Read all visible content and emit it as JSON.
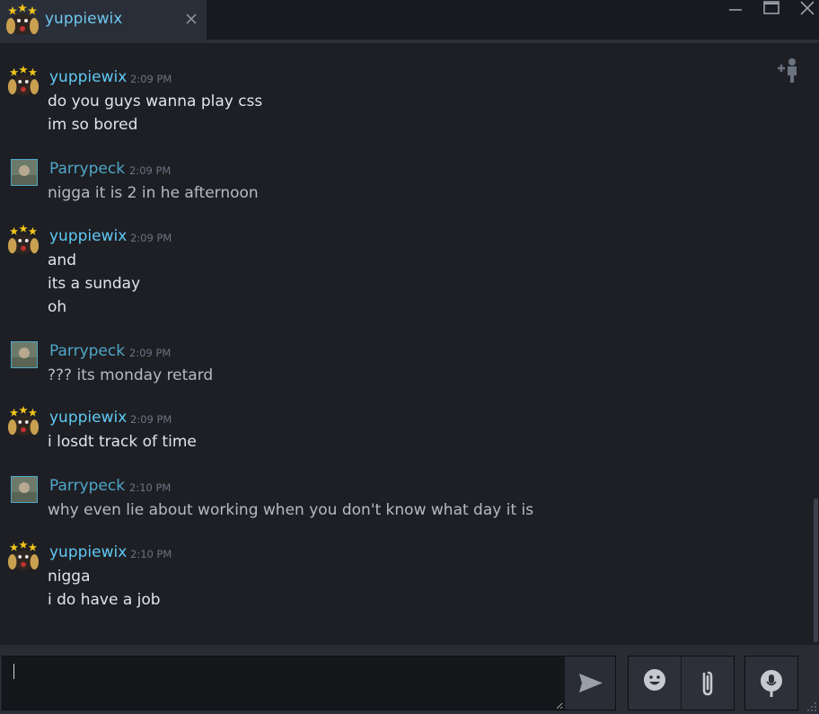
{
  "tab": {
    "name": "yuppiewix",
    "avatar_icon": "yuppiewix-avatar-icon",
    "close_icon": "close-icon"
  },
  "window_controls": {
    "minimize_icon": "minimize-icon",
    "maximize_icon": "maximize-icon",
    "close_icon": "close-icon"
  },
  "add_friend_icon": "add-friend-icon",
  "colors": {
    "self_name": "#5fcaf5",
    "other_name": "#4ea7c9",
    "background": "#1e1f24"
  },
  "messages": [
    {
      "author": "yuppiewix",
      "time": "2:09 PM",
      "avatar": "yuppiewix-avatar-icon",
      "lines": [
        "do you guys wanna play css",
        "im so bored"
      ]
    },
    {
      "author": "Parrypeck",
      "time": "2:09 PM",
      "avatar": "parrypeck-avatar-icon",
      "lines": [
        "nigga it is 2 in he afternoon"
      ]
    },
    {
      "author": "yuppiewix",
      "time": "2:09 PM",
      "avatar": "yuppiewix-avatar-icon",
      "lines": [
        "and",
        "its a sunday",
        "oh"
      ]
    },
    {
      "author": "Parrypeck",
      "time": "2:09 PM",
      "avatar": "parrypeck-avatar-icon",
      "lines": [
        "??? its monday retard"
      ]
    },
    {
      "author": "yuppiewix",
      "time": "2:09 PM",
      "avatar": "yuppiewix-avatar-icon",
      "lines": [
        "i losdt track of time"
      ]
    },
    {
      "author": "Parrypeck",
      "time": "2:10 PM",
      "avatar": "parrypeck-avatar-icon",
      "lines": [
        "why even lie about working when you don't know what day it is"
      ]
    },
    {
      "author": "yuppiewix",
      "time": "2:10 PM",
      "avatar": "yuppiewix-avatar-icon",
      "lines": [
        "nigga",
        "i do have a job"
      ]
    }
  ],
  "composer": {
    "value": "",
    "send_icon": "send-icon",
    "emoticon_icon": "emoticon-icon",
    "attach_icon": "paperclip-icon",
    "voice_icon": "microphone-icon"
  }
}
